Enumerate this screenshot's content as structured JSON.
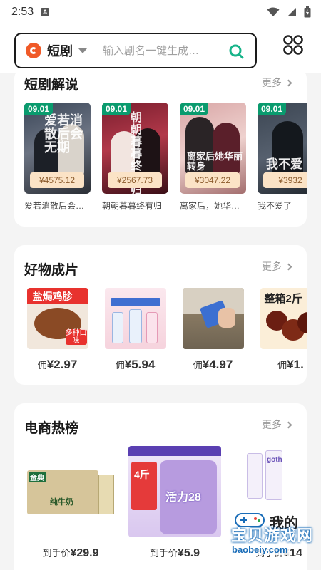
{
  "status": {
    "time": "2:53",
    "notif_glyph": "A"
  },
  "search": {
    "category": "短剧",
    "placeholder": "输入剧名一键生成…"
  },
  "sections": {
    "dramas": {
      "title": "短剧解说",
      "more": "更多",
      "items": [
        {
          "date": "09.01",
          "price": "¥4575.12",
          "name": "爱若消散后会…",
          "poster_text": "爱若消散后会无期"
        },
        {
          "date": "09.01",
          "price": "¥2567.73",
          "name": "朝朝暮暮终有归",
          "poster_text": "朝朝暮暮终有归"
        },
        {
          "date": "09.01",
          "price": "¥3047.22",
          "name": "离家后，她华…",
          "poster_text": "离家后她华丽转身"
        },
        {
          "date": "09.01",
          "price": "¥3932",
          "name": "我不爱了",
          "poster_text": "我不爱"
        }
      ]
    },
    "goods": {
      "title": "好物成片",
      "more": "更多",
      "items": [
        {
          "label": "佣",
          "price": "¥2.97",
          "img_text": "盐焗鸡胗",
          "img_badge": "多种口味"
        },
        {
          "label": "佣",
          "price": "¥5.94",
          "img_text": "",
          "img_badge": ""
        },
        {
          "label": "佣",
          "price": "¥4.97",
          "img_text": "",
          "img_badge": ""
        },
        {
          "label": "佣",
          "price": "¥1.",
          "img_text": "整箱2斤",
          "img_badge": ""
        }
      ]
    },
    "hot": {
      "title": "电商热榜",
      "more": "更多",
      "items": [
        {
          "label": "到手价",
          "price": "¥29.9",
          "img_text": "金典",
          "img_sub": "纯牛奶"
        },
        {
          "label": "到手价",
          "price": "¥5.9",
          "img_text": "活力28",
          "img_sub": "4斤"
        },
        {
          "label": "到手价",
          "price": "¥14",
          "img_text": "goth",
          "img_sub": ""
        }
      ]
    }
  },
  "watermark": {
    "title": "宝贝游戏网",
    "url": "baobeiy.com",
    "side": "我的"
  },
  "colors": {
    "accent": "#0a9b6e",
    "price_tag_bg": "#fbe3c6",
    "brand_orange": "#f05a28",
    "search_icon": "#18b48a"
  },
  "icons": [
    "logo-icon",
    "caret-down-icon",
    "search-icon",
    "grid-menu-icon",
    "chevron-right-icon",
    "wifi-icon",
    "signal-icon",
    "battery-icon"
  ]
}
